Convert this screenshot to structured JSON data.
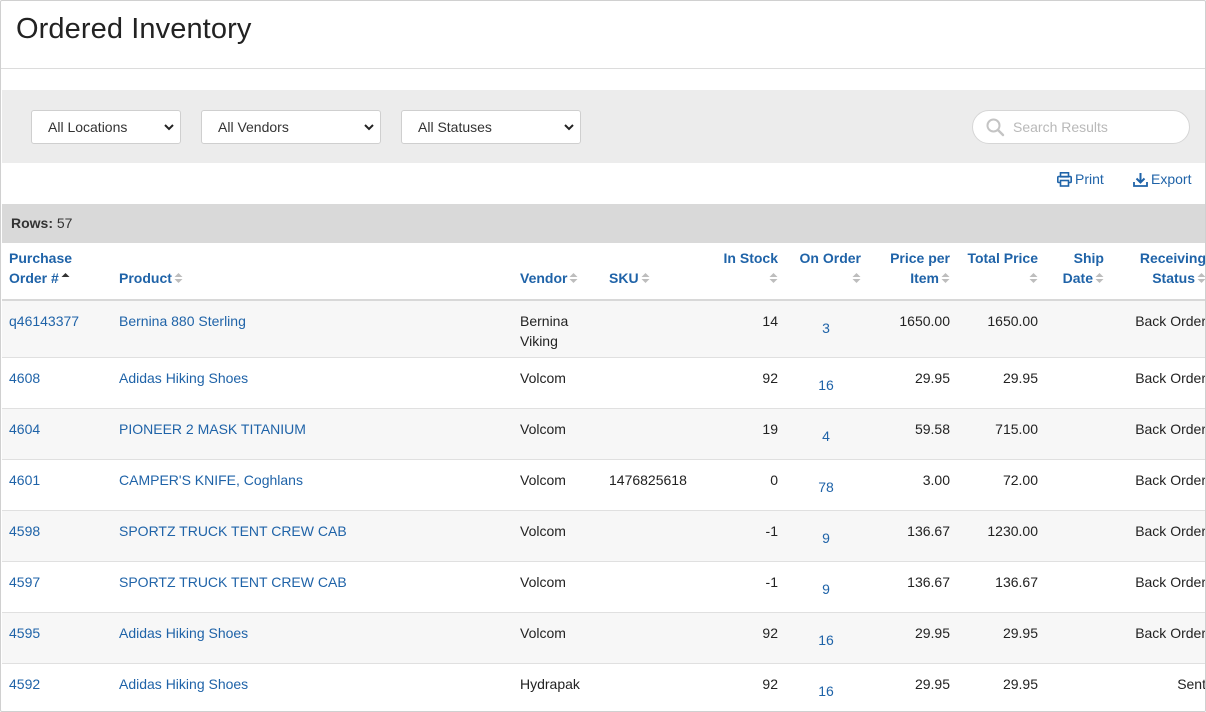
{
  "page": {
    "title": "Ordered Inventory"
  },
  "filters": {
    "locations": "All Locations",
    "vendors": "All Vendors",
    "statuses": "All Statuses"
  },
  "search": {
    "placeholder": "Search Results",
    "value": ""
  },
  "actions": {
    "print_label": "Print",
    "export_label": "Export"
  },
  "rows_info": {
    "label": "Rows:",
    "count": "57"
  },
  "colors": {
    "link": "#1f63a8",
    "filter_bg": "#ececec",
    "rows_bar_bg": "#d9d9d9"
  },
  "table": {
    "columns": [
      {
        "line1": "Purchase",
        "line2": "Order #",
        "sorted": "asc"
      },
      {
        "line1": "",
        "line2": "Product"
      },
      {
        "line1": "",
        "line2": "Vendor"
      },
      {
        "line1": "",
        "line2": "SKU"
      },
      {
        "line1": "In Stock",
        "line2": ""
      },
      {
        "line1": "On Order",
        "line2": ""
      },
      {
        "line1": "Price per",
        "line2": "Item"
      },
      {
        "line1": "Total Price",
        "line2": ""
      },
      {
        "line1": "Ship",
        "line2": "Date"
      },
      {
        "line1": "Receiving",
        "line2": "Status"
      }
    ],
    "rows": [
      {
        "po": "q46143377",
        "product": "Bernina 880 Sterling",
        "vendor": "Bernina Viking",
        "sku": "",
        "in_stock": "14",
        "on_order": "3",
        "price_per_item": "1650.00",
        "total_price": "1650.00",
        "ship_date": "",
        "status": "Back Order"
      },
      {
        "po": "4608",
        "product": "Adidas Hiking Shoes",
        "vendor": "Volcom",
        "sku": "",
        "in_stock": "92",
        "on_order": "16",
        "price_per_item": "29.95",
        "total_price": "29.95",
        "ship_date": "",
        "status": "Back Order"
      },
      {
        "po": "4604",
        "product": "PIONEER 2 MASK TITANIUM",
        "vendor": "Volcom",
        "sku": "",
        "in_stock": "19",
        "on_order": "4",
        "price_per_item": "59.58",
        "total_price": "715.00",
        "ship_date": "",
        "status": "Back Order"
      },
      {
        "po": "4601",
        "product": "CAMPER'S KNIFE, Coghlans",
        "vendor": "Volcom",
        "sku": "1476825618",
        "in_stock": "0",
        "on_order": "78",
        "price_per_item": "3.00",
        "total_price": "72.00",
        "ship_date": "",
        "status": "Back Order"
      },
      {
        "po": "4598",
        "product": "SPORTZ TRUCK TENT CREW CAB",
        "vendor": "Volcom",
        "sku": "",
        "in_stock": "-1",
        "on_order": "9",
        "price_per_item": "136.67",
        "total_price": "1230.00",
        "ship_date": "",
        "status": "Back Order"
      },
      {
        "po": "4597",
        "product": "SPORTZ TRUCK TENT CREW CAB",
        "vendor": "Volcom",
        "sku": "",
        "in_stock": "-1",
        "on_order": "9",
        "price_per_item": "136.67",
        "total_price": "136.67",
        "ship_date": "",
        "status": "Back Order"
      },
      {
        "po": "4595",
        "product": "Adidas Hiking Shoes",
        "vendor": "Volcom",
        "sku": "",
        "in_stock": "92",
        "on_order": "16",
        "price_per_item": "29.95",
        "total_price": "29.95",
        "ship_date": "",
        "status": "Back Order"
      },
      {
        "po": "4592",
        "product": "Adidas Hiking Shoes",
        "vendor": "Hydrapak",
        "sku": "",
        "in_stock": "92",
        "on_order": "16",
        "price_per_item": "29.95",
        "total_price": "29.95",
        "ship_date": "",
        "status": "Sent"
      }
    ]
  }
}
